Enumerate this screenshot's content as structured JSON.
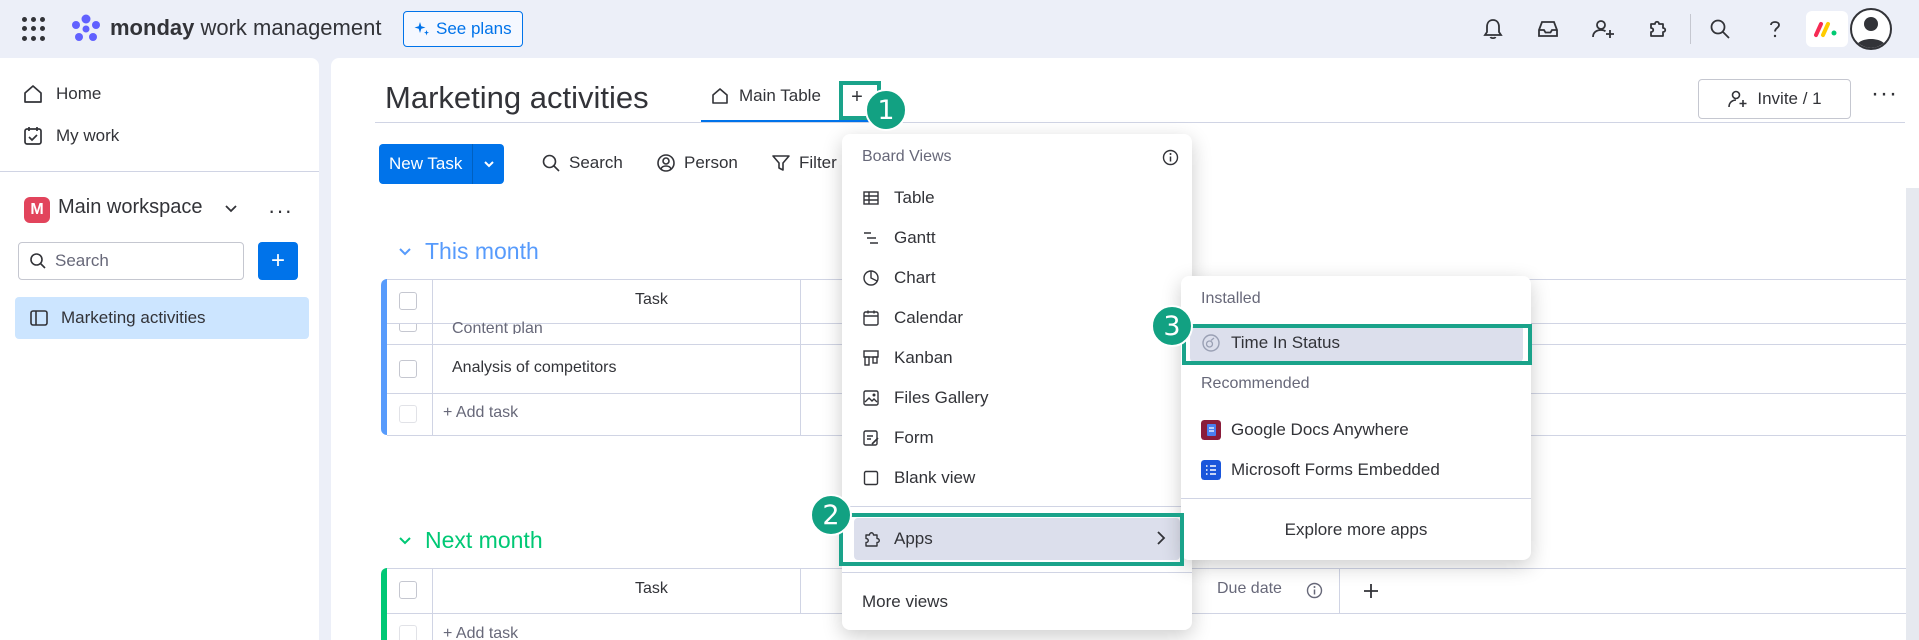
{
  "topbar": {
    "brand_bold": "monday",
    "brand_rest": " work management",
    "see_plans": "See plans",
    "icons": [
      "apps-grid-icon",
      "bell-icon",
      "inbox-icon",
      "invite-user-icon",
      "puzzle-icon",
      "search-icon",
      "help-icon"
    ]
  },
  "sidebar": {
    "home": "Home",
    "my_work": "My work",
    "workspace_initial": "M",
    "workspace": "Main workspace",
    "search_placeholder": "Search",
    "board": "Marketing activities"
  },
  "main": {
    "board_title": "Marketing activities",
    "tab_main": "Main Table",
    "tab_plus": "+",
    "invite": "Invite / 1",
    "new_task": "New Task",
    "tools": {
      "search": "Search",
      "person": "Person",
      "filter": "Filter"
    },
    "group1": {
      "title": "This month",
      "color": "#579bfc",
      "header_task": "Task",
      "rows": [
        "Content plan",
        "Analysis of competitors"
      ],
      "add_task": "+ Add task"
    },
    "group2": {
      "title": "Next month",
      "color": "#00c875",
      "header_task": "Task",
      "header_due": "Due date",
      "add_task": "+ Add task"
    }
  },
  "board_views_menu": {
    "header": "Board Views",
    "items": [
      "Table",
      "Gantt",
      "Chart",
      "Calendar",
      "Kanban",
      "Files Gallery",
      "Form",
      "Blank view"
    ],
    "apps": "Apps",
    "more_views": "More views"
  },
  "apps_menu": {
    "installed_header": "Installed",
    "installed": [
      "Time In Status"
    ],
    "recommended_header": "Recommended",
    "recommended": [
      "Google Docs Anywhere",
      "Microsoft Forms Embedded"
    ],
    "explore": "Explore more apps"
  },
  "annotations": {
    "steps": [
      "1",
      "2",
      "3"
    ],
    "color": "#1aa38a"
  }
}
